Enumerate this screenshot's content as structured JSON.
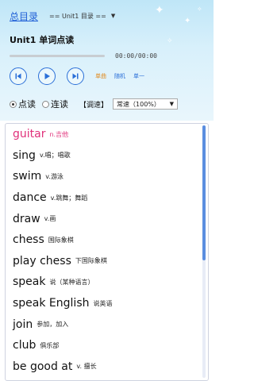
{
  "nav": {
    "home_link": "总目录",
    "unit_select": "== Unit1 目录 =="
  },
  "lesson": {
    "title": "Unit1 单词点读"
  },
  "player": {
    "progress": 0,
    "time": "00:00/00:00",
    "modes": {
      "single": "单曲",
      "random": "随机",
      "list": "单一"
    }
  },
  "options": {
    "mode_point": "点读",
    "mode_continuous": "连读",
    "speed_label": "【调速】",
    "speed_value": "常速（100%）",
    "selected_mode": "点读"
  },
  "words": [
    {
      "word": "guitar",
      "meaning": "n.吉他",
      "active": true
    },
    {
      "word": "sing",
      "meaning": "v.唱；唱歌",
      "active": false
    },
    {
      "word": "swim",
      "meaning": "v.游泳",
      "active": false
    },
    {
      "word": "dance",
      "meaning": "v.跳舞；舞蹈",
      "active": false
    },
    {
      "word": "draw",
      "meaning": "v.画",
      "active": false
    },
    {
      "word": "chess",
      "meaning": "国际象棋",
      "active": false
    },
    {
      "word": "play chess",
      "meaning": "下国际象棋",
      "active": false
    },
    {
      "word": "speak",
      "meaning": "说（某种语言）",
      "active": false
    },
    {
      "word": "speak English",
      "meaning": "说英语",
      "active": false
    },
    {
      "word": "join",
      "meaning": "参加，加入",
      "active": false
    },
    {
      "word": "club",
      "meaning": "俱乐部",
      "active": false
    },
    {
      "word": "be good at",
      "meaning": "v. 擅长",
      "active": false
    }
  ],
  "colors": {
    "accent": "#2a6fd8",
    "active_word": "#e0307a",
    "header_bg": "#cbeaf8"
  },
  "icons": {
    "prev": "skip-back-icon",
    "play": "play-icon",
    "next": "skip-forward-icon",
    "speed_caret": "chevron-down-icon"
  }
}
